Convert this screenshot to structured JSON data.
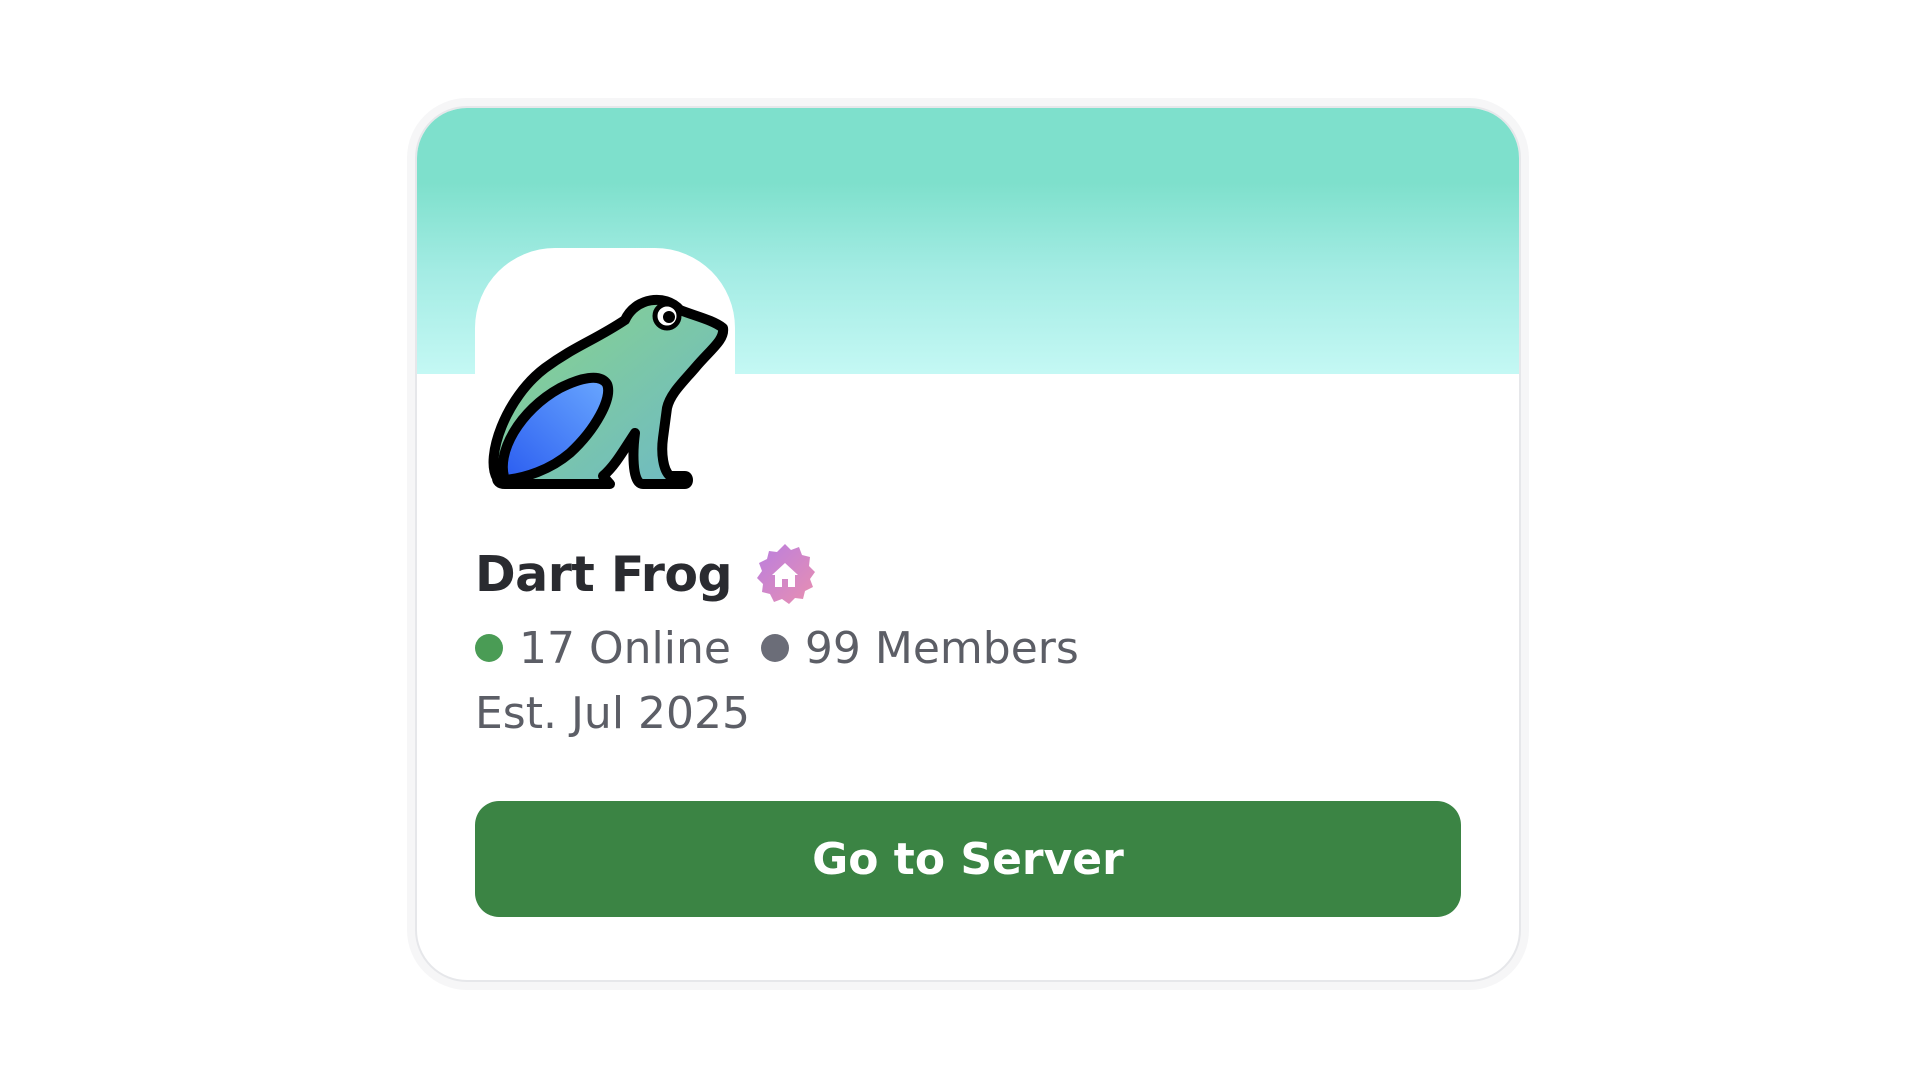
{
  "server": {
    "name": "Dart Frog",
    "badge_icon": "home-badge-icon",
    "avatar_icon": "frog-icon",
    "online_text": "17 Online",
    "members_text": "99 Members",
    "established_text": "Est. Jul 2025"
  },
  "actions": {
    "go_label": "Go to Server"
  },
  "colors": {
    "banner_top": "#7ee0cc",
    "banner_bottom": "#c4f8f4",
    "online_dot": "#4a9c55",
    "members_dot": "#6b6d78",
    "button": "#3b8444",
    "badge_start": "#b97ee0",
    "badge_end": "#e98fb0"
  }
}
